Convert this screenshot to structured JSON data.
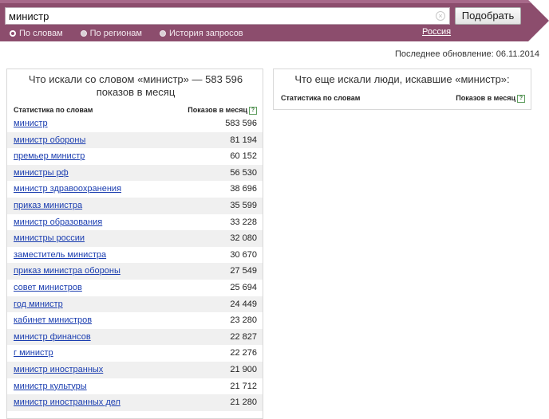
{
  "search": {
    "query": "министр",
    "submit_label": "Подобрать",
    "clear_glyph": "×"
  },
  "modes": [
    {
      "label": "По словам",
      "active": true
    },
    {
      "label": "По регионам",
      "active": false
    },
    {
      "label": "История запросов",
      "active": false
    }
  ],
  "region": "Россия",
  "updated": "Последнее обновление: 06.11.2014",
  "left_panel": {
    "title": "Что искали со словом «министр» — 583 596 показов в месяц",
    "col_words": "Статистика по словам",
    "col_shows": "Показов в месяц",
    "help_glyph": "?",
    "rows": [
      {
        "kw": "министр",
        "n": "583 596"
      },
      {
        "kw": "министр обороны",
        "n": "81 194"
      },
      {
        "kw": "премьер министр",
        "n": "60 152"
      },
      {
        "kw": "министры рф",
        "n": "56 530"
      },
      {
        "kw": "министр здравоохранения",
        "n": "38 696"
      },
      {
        "kw": "приказ министра",
        "n": "35 599"
      },
      {
        "kw": "министр образования",
        "n": "33 228"
      },
      {
        "kw": "министры россии",
        "n": "32 080"
      },
      {
        "kw": "заместитель министра",
        "n": "30 670"
      },
      {
        "kw": "приказ министра обороны",
        "n": "27 549"
      },
      {
        "kw": "совет министров",
        "n": "25 694"
      },
      {
        "kw": "год министр",
        "n": "24 449"
      },
      {
        "kw": "кабинет министров",
        "n": "23 280"
      },
      {
        "kw": "министр финансов",
        "n": "22 827"
      },
      {
        "kw": "г министр",
        "n": "22 276"
      },
      {
        "kw": "министр иностранных",
        "n": "21 900"
      },
      {
        "kw": "министр культуры",
        "n": "21 712"
      },
      {
        "kw": "министр иностранных дел",
        "n": "21 280"
      }
    ]
  },
  "right_panel": {
    "title": "Что еще искали люди, искавшие «министр»:",
    "col_words": "Статистика по словам",
    "col_shows": "Показов в месяц",
    "help_glyph": "?"
  },
  "colors": {
    "bar": "#8c4d6d",
    "link": "#1a3db0"
  }
}
